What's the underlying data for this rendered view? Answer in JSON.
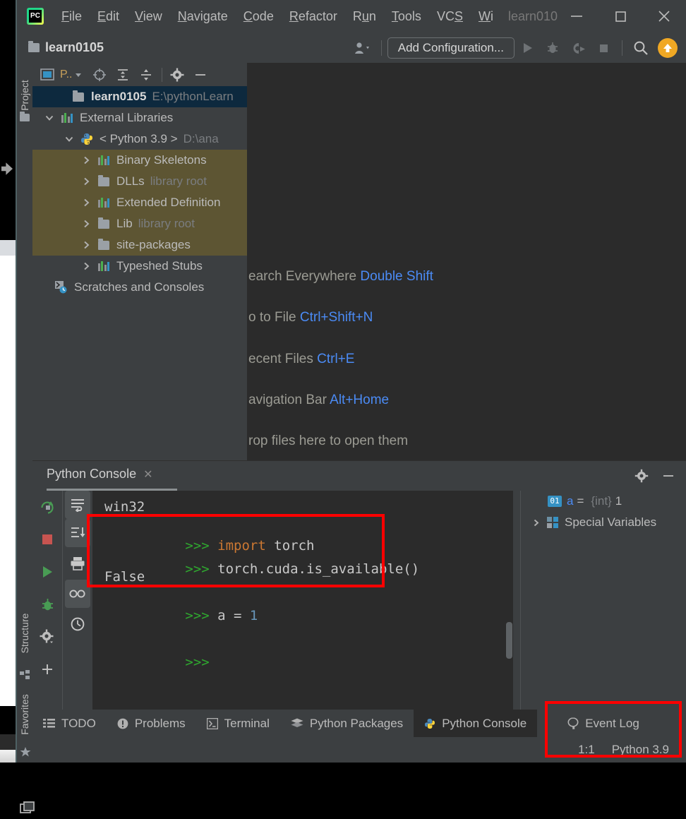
{
  "window": {
    "title": "learn010",
    "controls": [
      "minimize",
      "maximize",
      "close"
    ]
  },
  "menubar": {
    "items": [
      {
        "label": "File",
        "mnemonic": "F"
      },
      {
        "label": "Edit",
        "mnemonic": "E"
      },
      {
        "label": "View",
        "mnemonic": "V"
      },
      {
        "label": "Navigate",
        "mnemonic": "N"
      },
      {
        "label": "Code",
        "mnemonic": "C"
      },
      {
        "label": "Refactor",
        "mnemonic": "R"
      },
      {
        "label": "Run",
        "mnemonic": "u"
      },
      {
        "label": "Tools",
        "mnemonic": "T"
      },
      {
        "label": "VCS",
        "mnemonic": "S"
      },
      {
        "label": "Wi",
        "mnemonic": "W"
      }
    ]
  },
  "toolbar": {
    "project_name": "learn0105",
    "add_configuration": "Add Configuration...",
    "icons": [
      "user-dropdown-icon",
      "run-icon",
      "debug-icon",
      "coverage-icon",
      "stop-icon",
      "search-icon",
      "update-icon"
    ]
  },
  "left_strip": {
    "top_label": "Project",
    "bottom_labels": [
      "Structure",
      "Favorites"
    ]
  },
  "project_panel": {
    "view_selector": "P..",
    "tree": [
      {
        "name": "learn0105",
        "detail": "E:\\pythonLearn",
        "icon": "folder-icon",
        "indent": 0,
        "state": "selected",
        "twisty": ""
      },
      {
        "name": "External Libraries",
        "detail": "",
        "icon": "library-icon",
        "indent": 0,
        "state": "normal",
        "twisty": "expanded"
      },
      {
        "name": "< Python 3.9 >",
        "detail": "D:\\ana",
        "icon": "python-icon",
        "indent": 1,
        "state": "normal",
        "twisty": "expanded"
      },
      {
        "name": "Binary Skeletons",
        "detail": "",
        "icon": "library-icon",
        "indent": 2,
        "state": "highlighted",
        "twisty": "collapsed"
      },
      {
        "name": "DLLs",
        "detail": "library root",
        "icon": "folder-icon",
        "indent": 2,
        "state": "highlighted",
        "twisty": "collapsed"
      },
      {
        "name": "Extended Definition",
        "detail": "",
        "icon": "library-icon",
        "indent": 2,
        "state": "highlighted",
        "twisty": "collapsed"
      },
      {
        "name": "Lib",
        "detail": "library root",
        "icon": "folder-icon",
        "indent": 2,
        "state": "highlighted",
        "twisty": "collapsed"
      },
      {
        "name": "site-packages",
        "detail": "",
        "icon": "folder-icon",
        "indent": 2,
        "state": "highlighted",
        "twisty": "collapsed"
      },
      {
        "name": "Typeshed Stubs",
        "detail": "",
        "icon": "library-icon",
        "indent": 2,
        "state": "normal",
        "twisty": "collapsed"
      },
      {
        "name": "Scratches and Consoles",
        "detail": "",
        "icon": "scratches-icon",
        "indent": 0,
        "state": "normal",
        "twisty": ""
      }
    ]
  },
  "editor": {
    "hints": [
      {
        "action": "earch Everywhere",
        "shortcut": "Double Shift"
      },
      {
        "action": "o to File",
        "shortcut": "Ctrl+Shift+N"
      },
      {
        "action": "ecent Files",
        "shortcut": "Ctrl+E"
      },
      {
        "action": "avigation Bar",
        "shortcut": "Alt+Home"
      },
      {
        "action": "rop files here to open them",
        "shortcut": ""
      }
    ]
  },
  "console": {
    "tab_label": "Python Console",
    "lines": [
      {
        "prompt": "",
        "text": "win32",
        "kind": "plain"
      },
      {
        "prompt": ">>>",
        "text": "import torch",
        "kind": "keyword-import"
      },
      {
        "prompt": ">>>",
        "text": "torch.cuda.is_available()",
        "kind": "code"
      },
      {
        "prompt": "",
        "text": "False",
        "kind": "plain"
      },
      {
        "prompt": ">>>",
        "text": "a = 1",
        "kind": "assign"
      },
      {
        "prompt": ">>>",
        "text": "",
        "kind": "code"
      }
    ],
    "left_tools": [
      "rerun-icon",
      "stop-icon",
      "run-icon",
      "debug-icon",
      "settings-icon",
      "add-icon"
    ],
    "right_tools": [
      "soft-wrap-icon",
      "scroll-to-end-icon",
      "print-icon",
      "eyeglasses-icon",
      "history-icon"
    ],
    "panel_icons": [
      "gear-icon",
      "minimize-icon"
    ]
  },
  "variables": {
    "rows": [
      {
        "badge": "01",
        "name": "a",
        "type": "{int}",
        "value": "1",
        "twisty": ""
      },
      {
        "badge": "",
        "name": "Special Variables",
        "type": "",
        "value": "",
        "twisty": "collapsed"
      }
    ]
  },
  "bottom_bar": {
    "tabs": [
      {
        "label": "TODO",
        "icon": "todo-icon",
        "active": false
      },
      {
        "label": "Problems",
        "icon": "problems-icon",
        "active": false
      },
      {
        "label": "Terminal",
        "icon": "terminal-icon",
        "active": false
      },
      {
        "label": "Python Packages",
        "icon": "packages-icon",
        "active": false
      },
      {
        "label": "Python Console",
        "icon": "python-console-icon",
        "active": true
      },
      {
        "label": "Event Log",
        "icon": "event-log-icon",
        "active": false
      }
    ]
  },
  "status_bar": {
    "caret_position": "1:1",
    "interpreter": "Python 3.9"
  },
  "annotations": {
    "color": "#ff0000",
    "boxes": [
      "console-commands-highlight",
      "event-log-status-highlight"
    ]
  }
}
